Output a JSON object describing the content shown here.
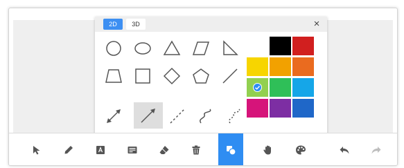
{
  "shapes_panel": {
    "tabs": [
      {
        "label": "2D",
        "active": true
      },
      {
        "label": "3D",
        "active": false
      }
    ],
    "close_label": "×",
    "shapes": [
      {
        "name": "circle-shape",
        "selected": false
      },
      {
        "name": "ellipse-shape",
        "selected": false
      },
      {
        "name": "triangle-shape",
        "selected": false
      },
      {
        "name": "parallelogram-shape",
        "selected": false
      },
      {
        "name": "right-triangle-shape",
        "selected": false
      },
      {
        "name": "trapezoid-shape",
        "selected": false
      },
      {
        "name": "square-shape",
        "selected": false
      },
      {
        "name": "diamond-shape",
        "selected": false
      },
      {
        "name": "pentagon-shape",
        "selected": false
      },
      {
        "name": "line-shape",
        "selected": false
      },
      {
        "name": "double-arrow-shape",
        "selected": false
      },
      {
        "name": "arrow-shape",
        "selected": true
      },
      {
        "name": "dashed-line-shape",
        "selected": false
      },
      {
        "name": "curve-shape",
        "selected": false
      },
      {
        "name": "dashed-curve-shape",
        "selected": false
      }
    ]
  },
  "palette": {
    "colors": [
      "#ffffff",
      "#000000",
      "#d11f1f",
      "#f7d500",
      "#f2a100",
      "#ea6b1f",
      "#92d050",
      "#2fbf58",
      "#15a6e8",
      "#d6147a",
      "#7d2ea3",
      "#1f67c8"
    ],
    "selected_index": 6
  },
  "toolbar": {
    "tools": [
      {
        "name": "select-icon",
        "active": false
      },
      {
        "name": "pen-icon",
        "active": false
      },
      {
        "name": "text-icon",
        "active": false
      },
      {
        "name": "image-icon",
        "active": false
      },
      {
        "name": "eraser-icon",
        "active": false
      },
      {
        "name": "trash-icon",
        "active": false
      },
      {
        "name": "shapes-icon",
        "active": true
      },
      {
        "name": "hand-icon",
        "active": false
      },
      {
        "name": "palette-icon",
        "active": false
      },
      {
        "name": "undo-icon",
        "active": false
      },
      {
        "name": "redo-icon",
        "active": false
      }
    ],
    "accent_color": "#2f8df2"
  }
}
